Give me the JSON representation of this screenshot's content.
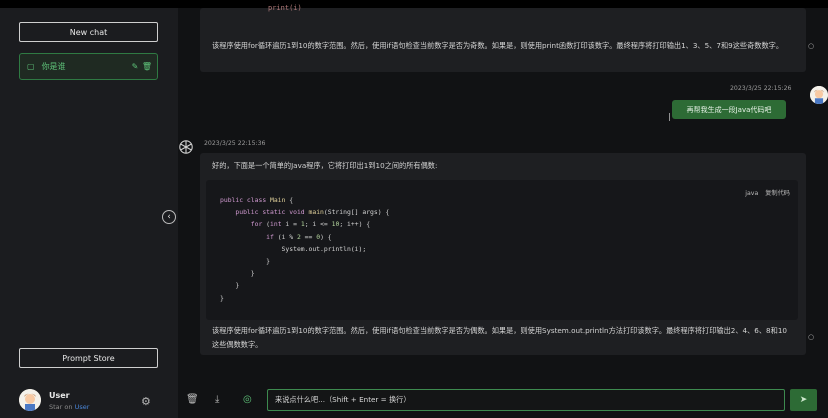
{
  "sidebar": {
    "new_chat": "New chat",
    "chats": [
      {
        "label": "你是谁",
        "icon": "chat-square-icon"
      }
    ],
    "prompt_store": "Prompt Store",
    "user": {
      "name": "User",
      "star_prefix": "Star on",
      "star_link": "User"
    }
  },
  "messages": {
    "top_code_fragment": "print(i)",
    "top_text": "该程序使用for循环遍历1到10的数字范围。然后，使用if语句检查当前数字是否为奇数。如果是，则使用print函数打印该数字。最终程序将打印输出1、3、5、7和9这些奇数数字。",
    "user_time": "2023/3/25 22:15:26",
    "user_text": "再帮我生成一段Java代码吧",
    "bot_time": "2023/3/25 22:15:36",
    "bot_intro": "好的，下面是一个简单的Java程序，它将打印出1到10之间的所有偶数:",
    "code_lang": "java",
    "copy_code": "复制代码",
    "code_lines": [
      "public class Main {",
      "    public static void main(String[] args) {",
      "        for (int i = 1; i <= 10; i++) {",
      "            if (i % 2 == 0) {",
      "                System.out.println(i);",
      "            }",
      "        }",
      "    }",
      "}"
    ],
    "bot_outro": "该程序使用for循环遍历1到10的数字范围。然后，使用if语句检查当前数字是否为偶数。如果是，则使用System.out.println方法打印该数字。最终程序将打印输出2、4、6、8和10这些偶数数字。"
  },
  "input": {
    "placeholder": "来说点什么吧...（Shift + Enter = 换行）"
  },
  "colors": {
    "accent": "#2d6b35",
    "border_accent": "#3d8a4f"
  }
}
